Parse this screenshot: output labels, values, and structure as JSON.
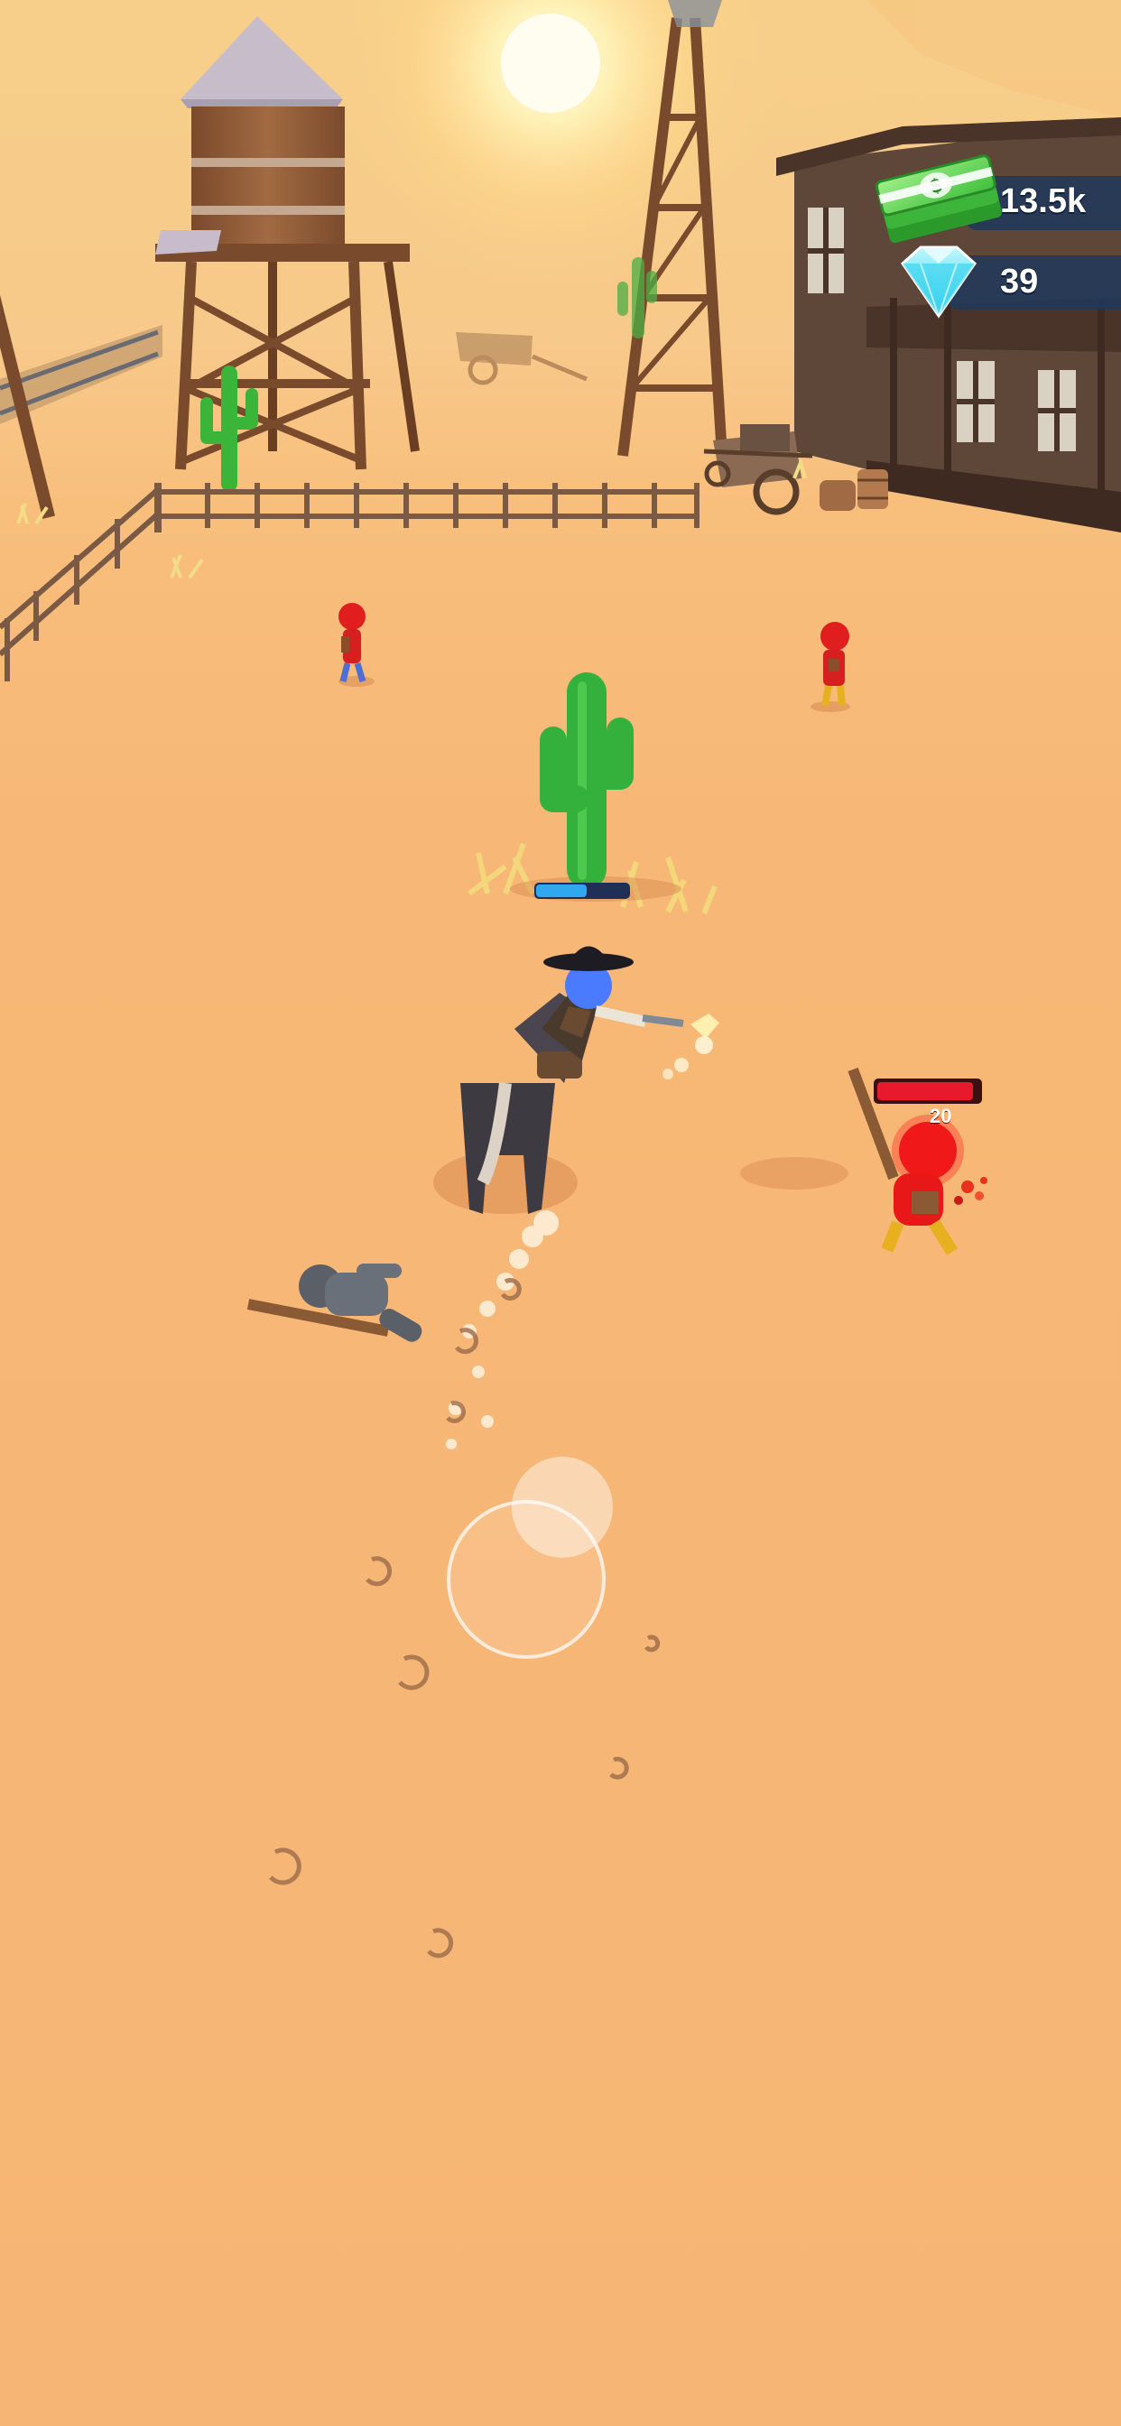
{
  "hud": {
    "cash": {
      "icon": "cash-stack-icon",
      "value": "13.5k"
    },
    "gems": {
      "icon": "diamond-icon",
      "value": "39"
    }
  },
  "player": {
    "health_fraction": 0.55
  },
  "enemy": {
    "health_fraction": 0.95,
    "damage_number": "20"
  },
  "joystick": {
    "icon": "virtual-joystick"
  },
  "colors": {
    "sand": "#f6b876",
    "hud_panel": "#21385c",
    "player_health": "#2fa8f0",
    "enemy_health": "#e8192c",
    "enemy": "#e02020",
    "player_body": "#4a7bff"
  }
}
